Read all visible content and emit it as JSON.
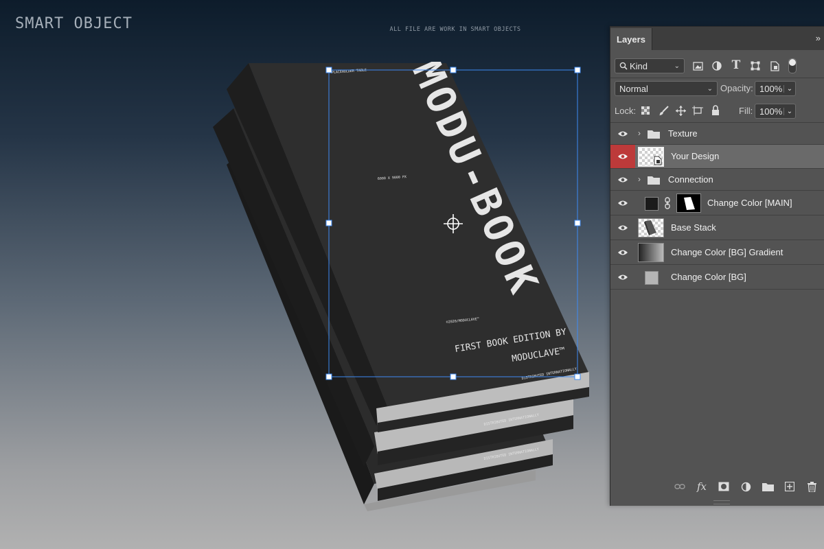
{
  "canvas": {
    "title": "SMART OBJECT",
    "subtitle": "ALL FILE ARE WORK IN SMART OBJECTS",
    "book": {
      "title": "MODU-BOOK",
      "tagline_line1": "FIRST BOOK EDITION BY",
      "tagline_line2": "MODUCLAVE™",
      "small_top": "PLACEHOLDER TABLE",
      "size_label": "6000 X 9000 PX",
      "copyright": "©2020/MODUCLAVE™",
      "distributed": "DISTRIBUTED INTERNATIONALLY",
      "spine_text": "DISTRIBUTED INTERNATIONALLY"
    }
  },
  "layers_panel": {
    "tab_label": "Layers",
    "collapse_icon": "»",
    "filter": {
      "kind_label": "Kind"
    },
    "blend_mode": "Normal",
    "opacity_label": "Opacity:",
    "opacity_value": "100%",
    "lock_label": "Lock:",
    "fill_label": "Fill:",
    "fill_value": "100%",
    "layers": [
      {
        "name": "Texture",
        "type": "group",
        "visible": true
      },
      {
        "name": "Your Design",
        "type": "smart-object",
        "visible": true,
        "selected": true
      },
      {
        "name": "Connection",
        "type": "group",
        "visible": true
      },
      {
        "name": "Change Color [MAIN]",
        "type": "adjustment-with-mask",
        "visible": true
      },
      {
        "name": "Base Stack",
        "type": "smart-object",
        "visible": true
      },
      {
        "name": "Change Color [BG] Gradient",
        "type": "gradient-fill",
        "visible": true
      },
      {
        "name": "Change Color [BG]",
        "type": "solid-fill",
        "visible": true
      }
    ]
  },
  "colors": {
    "selection_eye": "#bd3a3a",
    "transform_box": "#3d8bf5"
  }
}
